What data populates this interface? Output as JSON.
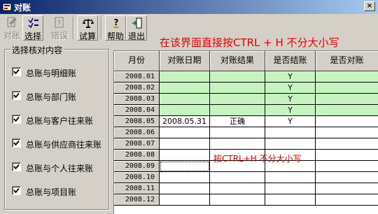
{
  "window": {
    "title": "对账",
    "close_glyph": "×"
  },
  "toolbar": {
    "buttons": [
      {
        "label": "对账",
        "icon": "reconcile-icon",
        "disabled": true
      },
      {
        "label": "选择",
        "icon": "select-list-icon",
        "disabled": false
      },
      {
        "label": "错误",
        "icon": "error-doc-icon",
        "disabled": true
      },
      {
        "label": "试算",
        "icon": "balance-scale-icon",
        "disabled": false
      },
      {
        "label": "帮助",
        "icon": "help-icon",
        "disabled": false
      },
      {
        "label": "退出",
        "icon": "exit-door-icon",
        "disabled": false
      }
    ]
  },
  "notice": "在该界面直接按CTRL + H 不分大小写",
  "group": {
    "title": "选择核对内容",
    "items": [
      {
        "label": "总账与明细账",
        "checked": true
      },
      {
        "label": "总账与部门账",
        "checked": true
      },
      {
        "label": "总账与客户往来账",
        "checked": true
      },
      {
        "label": "总账与供应商往来账",
        "checked": true
      },
      {
        "label": "总账与个人往来账",
        "checked": true
      },
      {
        "label": "总账与项目账",
        "checked": true
      }
    ]
  },
  "grid": {
    "columns": [
      "月份",
      "对账日期",
      "对账结果",
      "是否结账",
      "是否对账"
    ],
    "rows": [
      {
        "month": "2008.01",
        "date": "",
        "result": "",
        "closed": "Y",
        "reconciled": "",
        "green": true
      },
      {
        "month": "2008.02",
        "date": "",
        "result": "",
        "closed": "Y",
        "reconciled": "",
        "green": true
      },
      {
        "month": "2008.03",
        "date": "",
        "result": "",
        "closed": "Y",
        "reconciled": "",
        "green": true
      },
      {
        "month": "2008.04",
        "date": "",
        "result": "",
        "closed": "Y",
        "reconciled": "",
        "green": true
      },
      {
        "month": "2008.05",
        "date": "2008.05.31",
        "result": "正确",
        "closed": "Y",
        "reconciled": "",
        "green": false
      },
      {
        "month": "2008.06",
        "date": "",
        "result": "",
        "closed": "",
        "reconciled": "",
        "green": false
      },
      {
        "month": "2008.07",
        "date": "",
        "result": "",
        "closed": "",
        "reconciled": "",
        "green": false
      },
      {
        "month": "2008.08",
        "date": "",
        "result": "",
        "closed": "",
        "reconciled": "",
        "green": false
      },
      {
        "month": "2008.09",
        "date": "",
        "result": "",
        "closed": "",
        "reconciled": "",
        "green": false
      },
      {
        "month": "2008.10",
        "date": "",
        "result": "",
        "closed": "",
        "reconciled": "",
        "green": false
      },
      {
        "month": "2008.11",
        "date": "",
        "result": "",
        "closed": "",
        "reconciled": "",
        "green": false
      },
      {
        "month": "2008.12",
        "date": "",
        "result": "",
        "closed": "",
        "reconciled": "",
        "green": false
      }
    ],
    "note": "按CTRL+H 不分大小写"
  },
  "colors": {
    "highlight_row": "#c6f4c0",
    "notice_red": "#e00000",
    "title_bar": "#0a246a"
  }
}
